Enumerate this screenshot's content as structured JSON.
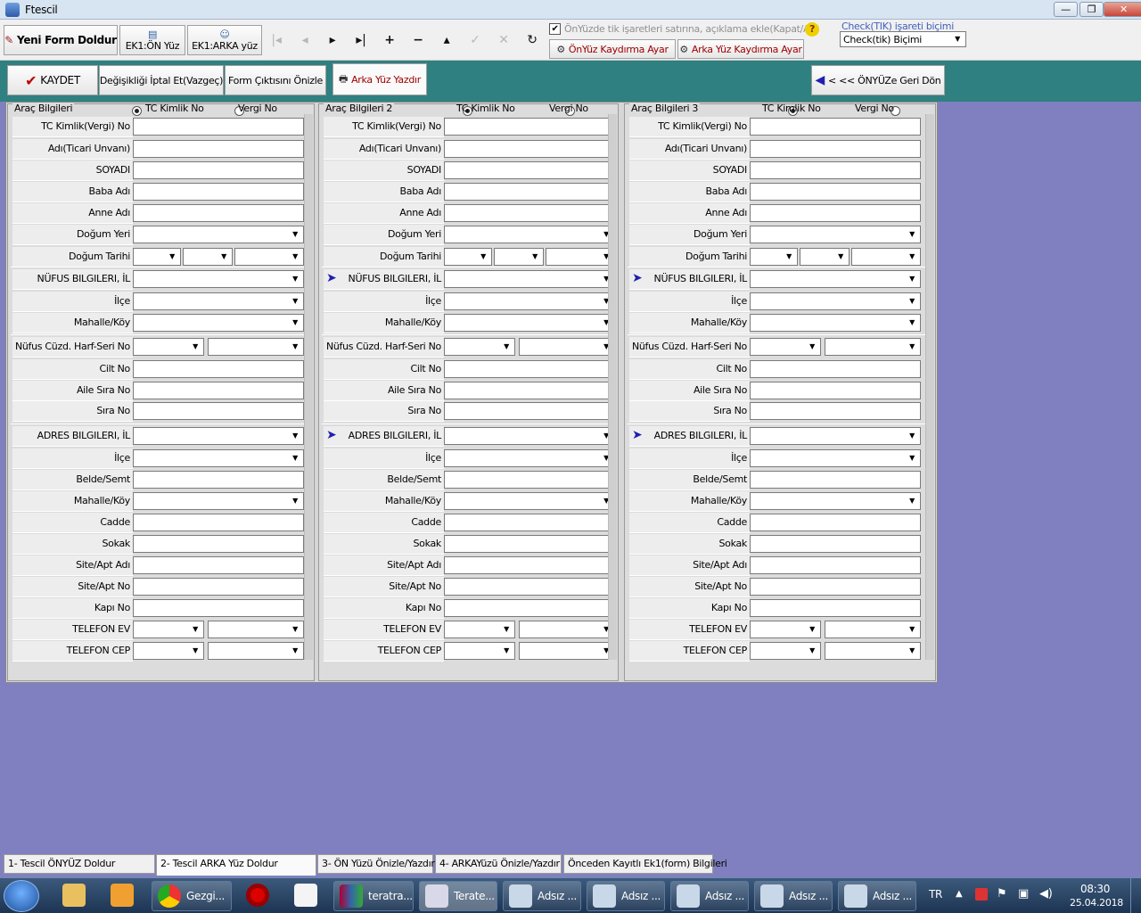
{
  "window": {
    "title": "Ftescil",
    "min": "—",
    "max": "❐",
    "close": "✕"
  },
  "toolbar": {
    "new_form": "Yeni Form Doldur",
    "ek1_front": "EK1:ÖN Yüz",
    "ek1_back": "EK1:ARKA yüz",
    "nav": [
      "|◂",
      "◂",
      "▸",
      "▸|",
      "+",
      "−",
      "▴",
      "✓",
      "✕",
      "↻"
    ],
    "checkbox_label": "ÖnYüzde tik işaretleri satırına, açıklama ekle(Kapat/Aç)",
    "help": "?",
    "front_shift": "ÖnYüz Kaydırma Ayar",
    "back_shift": "Arka Yüz Kaydırma Ayar",
    "check_group": "Check(TIK) işareti biçimi",
    "check_select": "Check(tik) Biçimi"
  },
  "actions": {
    "save": "KAYDET",
    "cancel": "Değişikliği İptal Et(Vazgeç)",
    "preview": "Form Çıktısını Önizle",
    "print_back": "Arka Yüz Yazdır",
    "back_front": "< << ÖNYÜZe Geri Dön"
  },
  "panels": [
    {
      "title": "Araç Bilgileri",
      "radio1": "TC Kimlik No",
      "radio2": "Vergi No"
    },
    {
      "title": "Araç Bilgileri 2",
      "radio1": "TC Kimlik No",
      "radio2": "Vergi No"
    },
    {
      "title": "Araç Bilgileri 3",
      "radio1": "TC Kimlik No",
      "radio2": "Vergi No"
    }
  ],
  "fields": {
    "tc": "TC Kimlik(Vergi) No",
    "ad": "Adı(Ticari Unvanı)",
    "soyadi": "SOYADI",
    "baba": "Baba Adı",
    "anne": "Anne Adı",
    "dogum_yeri": "Doğum Yeri",
    "dogum_tarihi": "Doğum Tarihi",
    "nufus_il": "NÜFUS BILGILERI, İL",
    "ilce": "İlçe",
    "mahalle": "Mahalle/Köy",
    "cuzdan": "Nüfus Cüzd. Harf-Seri No",
    "cilt": "Cilt No",
    "aile": "Aile Sıra No",
    "sira": "Sıra No",
    "adres_il": "ADRES BILGILERI, İL",
    "belde": "Belde/Semt",
    "cadde": "Cadde",
    "sokak": "Sokak",
    "site_adi": "Site/Apt Adı",
    "site_no": "Site/Apt No",
    "kapi": "Kapı No",
    "tel_ev": "TELEFON EV",
    "tel_cep": "TELEFON CEP"
  },
  "tabs": [
    "1- Tescil ÖNYÜZ Doldur",
    "2- Tescil ARKA Yüz Doldur",
    "3- ÖN Yüzü Önizle/Yazdır",
    "4- ARKAYüzü Önizle/Yazdır",
    "Önceden Kayıtlı Ek1(form) Bilgileri"
  ],
  "taskbar": {
    "items": [
      "Gezgi...",
      "teratra...",
      "Terate...",
      "Adsız ...",
      "Adsız ...",
      "Adsız ...",
      "Adsız ...",
      "Adsız ..."
    ],
    "lang": "TR",
    "time": "08:30",
    "date": "25.04.2018"
  },
  "colors": {
    "accent": "#2f8080",
    "background": "#8080c0"
  }
}
